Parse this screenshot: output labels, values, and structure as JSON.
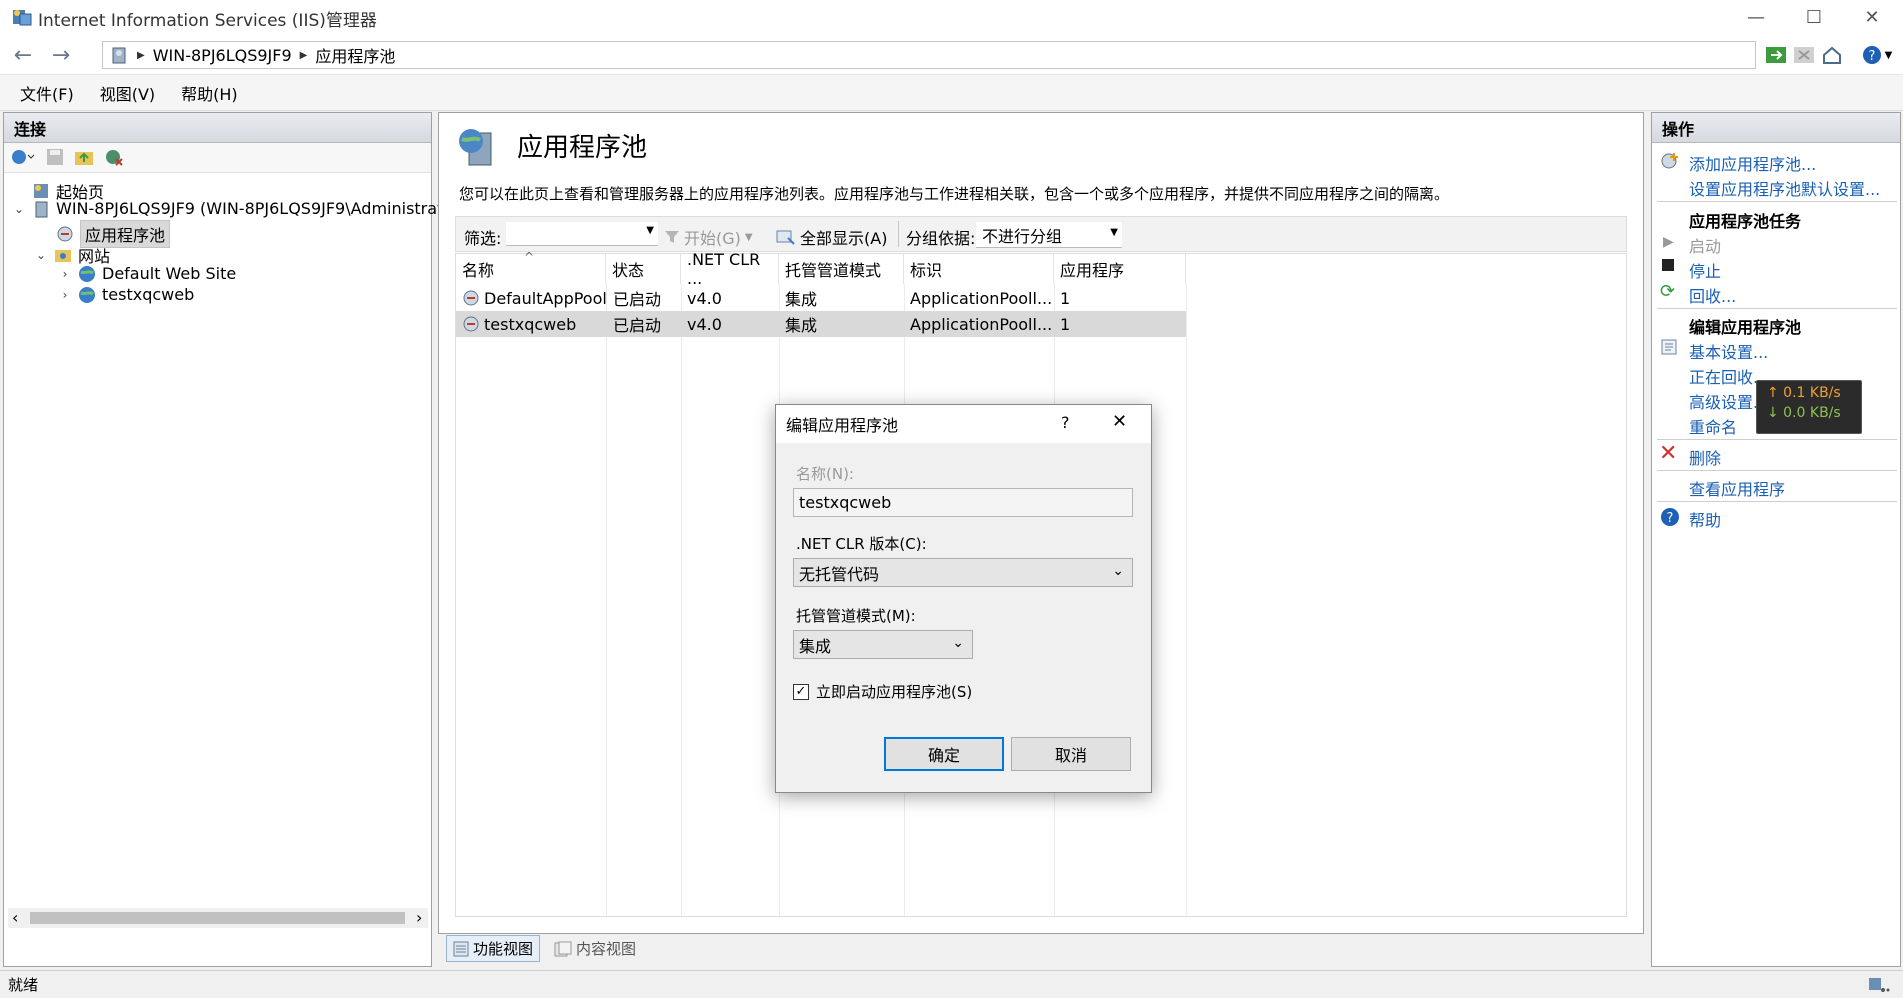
{
  "window": {
    "title": "Internet Information Services (IIS)管理器",
    "min_icon": "minimize-icon",
    "max_icon": "maximize-icon",
    "close_icon": "close-icon"
  },
  "address": {
    "crumbs": [
      "WIN-8PJ6LQS9JF9",
      "应用程序池"
    ]
  },
  "menu": [
    "文件(F)",
    "视图(V)",
    "帮助(H)"
  ],
  "connections": {
    "header": "连接",
    "tree": [
      {
        "label": "起始页",
        "level": 1
      },
      {
        "label": "WIN-8PJ6LQS9JF9 (WIN-8PJ6LQS9JF9\\Administrato",
        "level": 0
      },
      {
        "label": "应用程序池",
        "level": 2
      },
      {
        "label": "网站",
        "level": 1
      },
      {
        "label": "Default Web Site",
        "level": 2
      },
      {
        "label": "testxqcweb",
        "level": 2
      }
    ]
  },
  "main": {
    "title": "应用程序池",
    "description": "您可以在此页上查看和管理服务器上的应用程序池列表。应用程序池与工作进程相关联，包含一个或多个应用程序，并提供不同应用程序之间的隔离。",
    "filter_label": "筛选:",
    "start_label": "开始(G)",
    "show_all_label": "全部显示(A)",
    "group_by_label": "分组依据:",
    "group_by_value": "不进行分组",
    "columns": [
      "名称",
      "状态",
      ".NET CLR ...",
      "托管管道模式",
      "标识",
      "应用程序"
    ],
    "rows": [
      [
        "DefaultAppPool",
        "已启动",
        "v4.0",
        "集成",
        "ApplicationPooll...",
        "1"
      ],
      [
        "testxqcweb",
        "已启动",
        "v4.0",
        "集成",
        "ApplicationPooll...",
        "1"
      ]
    ],
    "view_tabs": [
      "功能视图",
      "内容视图"
    ]
  },
  "actions": {
    "header": "操作",
    "add_pool": "添加应用程序池...",
    "set_defaults": "设置应用程序池默认设置...",
    "tasks_title": "应用程序池任务",
    "start": "启动",
    "stop": "停止",
    "recycle": "回收...",
    "edit_title": "编辑应用程序池",
    "basic_settings": "基本设置...",
    "recycling": "正在回收...",
    "advanced": "高级设置...",
    "rename": "重命名",
    "delete": "删除",
    "view_apps": "查看应用程序",
    "help": "帮助"
  },
  "net_overlay": {
    "up": "↑ 0.1 KB/s",
    "down": "↓ 0.0 KB/s",
    "up_color": "#f0a030",
    "down_color": "#8fc050"
  },
  "dialog": {
    "title": "编辑应用程序池",
    "help": "?",
    "name_label": "名称(N):",
    "name_value": "testxqcweb",
    "clr_label": ".NET CLR 版本(C):",
    "clr_value": "无托管代码",
    "pipeline_label": "托管管道模式(M):",
    "pipeline_value": "集成",
    "autostart_label": "立即启动应用程序池(S)",
    "autostart_checked": true,
    "ok": "确定",
    "cancel": "取消"
  },
  "status": {
    "text": "就绪"
  },
  "colors": {
    "link": "#1a5fb4",
    "accent": "#0078d7",
    "selection": "#d9d9d9"
  }
}
